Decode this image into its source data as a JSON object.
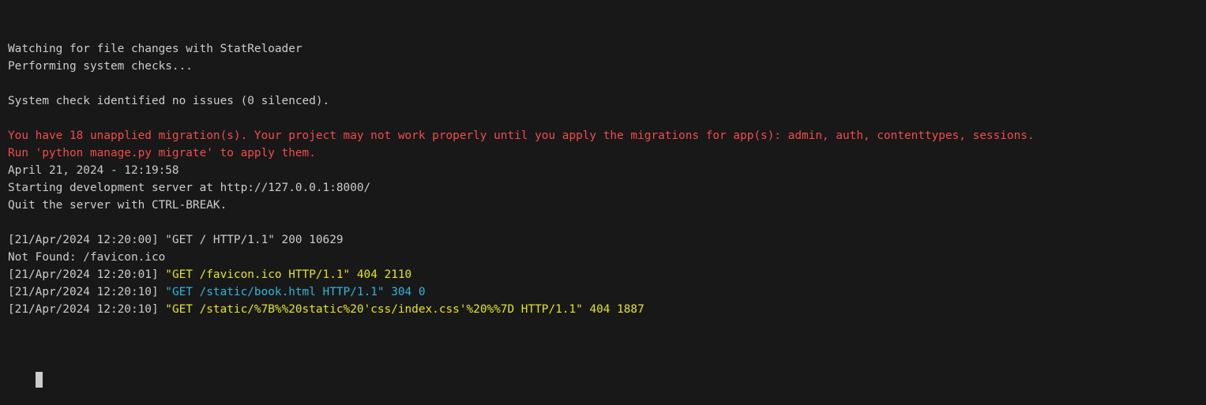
{
  "colors": {
    "background": "#181818",
    "default": "#cccccc",
    "error": "#f14c4c",
    "yellow": "#e5e510",
    "blue": "#29b8db",
    "cursor": "#cccccc"
  },
  "terminal": {
    "lines": [
      {
        "segments": [
          {
            "text": "Watching for file changes with StatReloader",
            "color": "#cccccc"
          }
        ]
      },
      {
        "segments": [
          {
            "text": "Performing system checks...",
            "color": "#cccccc"
          }
        ]
      },
      {
        "segments": []
      },
      {
        "segments": [
          {
            "text": "System check identified no issues (0 silenced).",
            "color": "#cccccc"
          }
        ]
      },
      {
        "segments": []
      },
      {
        "segments": [
          {
            "text": "You have 18 unapplied migration(s). Your project may not work properly until you apply the migrations for app(s): admin, auth, contenttypes, sessions.",
            "color": "#f14c4c"
          }
        ]
      },
      {
        "segments": [
          {
            "text": "Run 'python manage.py migrate' to apply them.",
            "color": "#f14c4c"
          }
        ]
      },
      {
        "segments": [
          {
            "text": "April 21, 2024 - 12:19:58",
            "color": "#cccccc"
          }
        ]
      },
      {
        "segments": [
          {
            "text": "Starting development server at http://127.0.0.1:8000/",
            "color": "#cccccc"
          }
        ]
      },
      {
        "segments": [
          {
            "text": "Quit the server with CTRL-BREAK.",
            "color": "#cccccc"
          }
        ]
      },
      {
        "segments": []
      },
      {
        "segments": [
          {
            "text": "[21/Apr/2024 12:20:00] \"GET / HTTP/1.1\" 200 10629",
            "color": "#cccccc"
          }
        ]
      },
      {
        "segments": [
          {
            "text": "Not Found: /favicon.ico",
            "color": "#cccccc"
          }
        ]
      },
      {
        "segments": [
          {
            "text": "[21/Apr/2024 12:20:01] ",
            "color": "#cccccc"
          },
          {
            "text": "\"GET /favicon.ico HTTP/1.1\" 404 2110",
            "color": "#e5e510"
          }
        ]
      },
      {
        "segments": [
          {
            "text": "[21/Apr/2024 12:20:10] ",
            "color": "#cccccc"
          },
          {
            "text": "\"GET /static/book.html HTTP/1.1\" 304 0",
            "color": "#29b8db"
          }
        ]
      },
      {
        "segments": [
          {
            "text": "[21/Apr/2024 12:20:10] ",
            "color": "#cccccc"
          },
          {
            "text": "\"GET /static/%7B%%20static%20'css/index.css'%20%%7D HTTP/1.1\" 404 1887",
            "color": "#e5e510"
          }
        ]
      }
    ]
  }
}
